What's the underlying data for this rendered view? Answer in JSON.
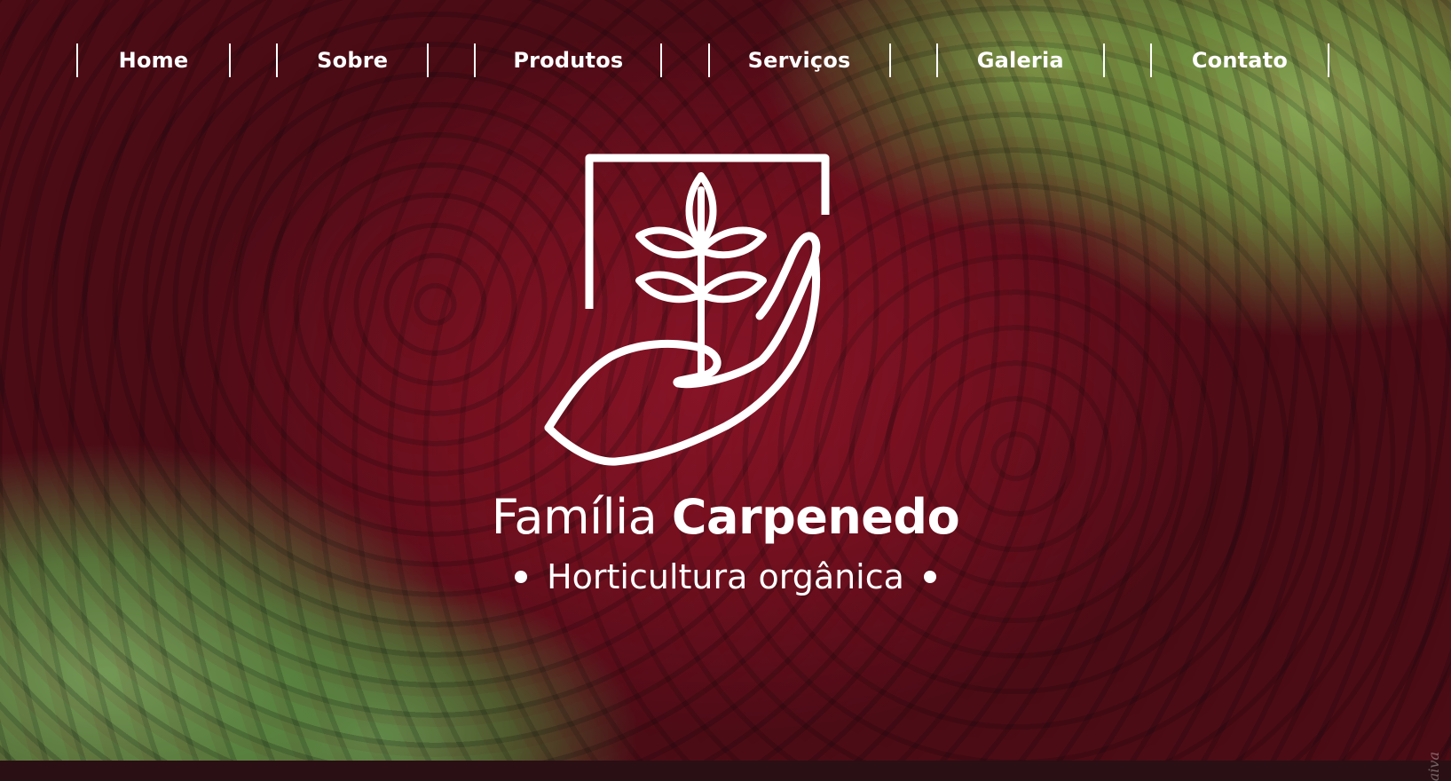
{
  "nav": {
    "items": [
      {
        "label": "Home"
      },
      {
        "label": "Sobre"
      },
      {
        "label": "Produtos"
      },
      {
        "label": "Serviços"
      },
      {
        "label": "Galeria"
      },
      {
        "label": "Contato"
      }
    ]
  },
  "hero": {
    "brand_light": "Família",
    "brand_bold": "Carpenedo",
    "tagline": "Horticultura orgânica",
    "logo_icon": "hand-holding-plant-icon",
    "watermark": "aiva"
  },
  "colors": {
    "text": "#ffffff",
    "foliage_red": "#a8182f",
    "foliage_green": "#8fc06a"
  }
}
